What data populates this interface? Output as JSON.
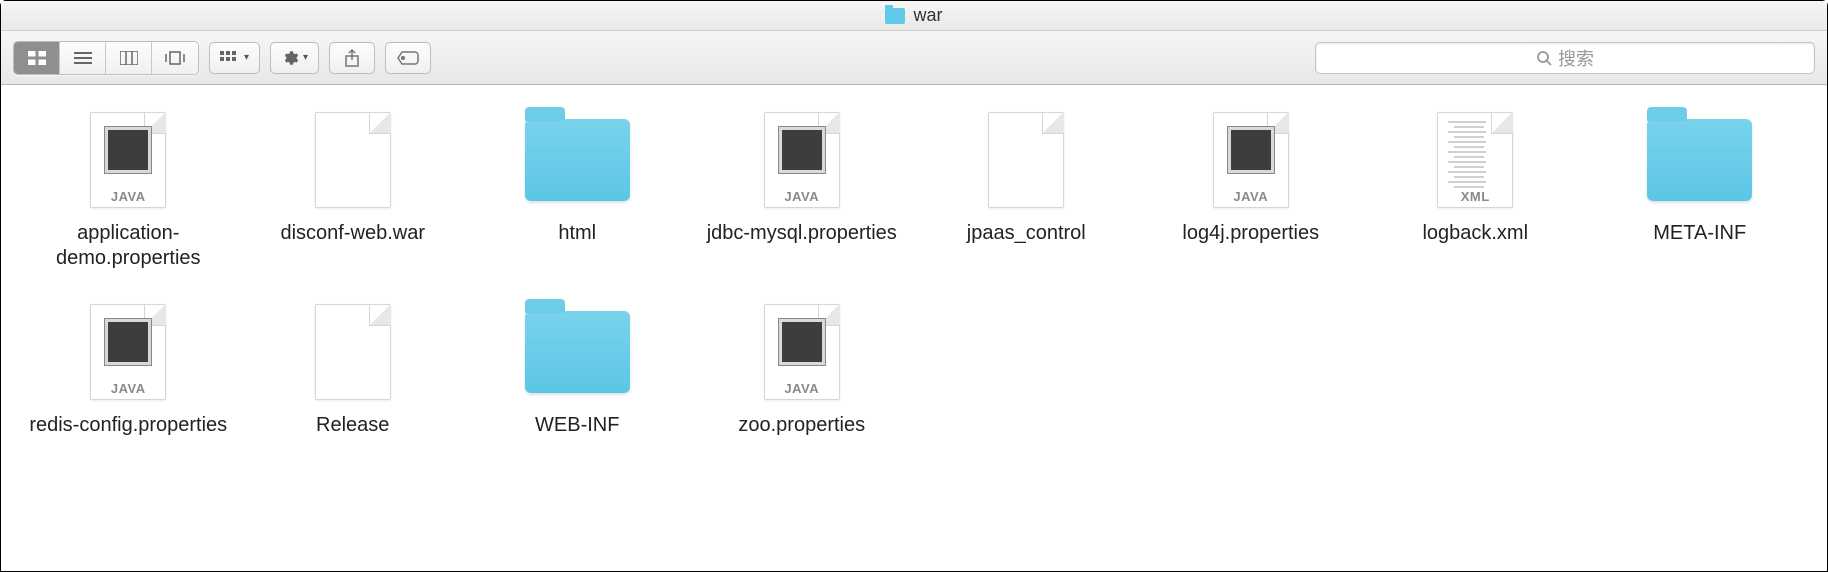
{
  "window": {
    "title": "war"
  },
  "toolbar": {
    "search_placeholder": "搜索"
  },
  "items": [
    {
      "name": "application-demo.properties",
      "type": "java"
    },
    {
      "name": "disconf-web.war",
      "type": "blank"
    },
    {
      "name": "html",
      "type": "folder"
    },
    {
      "name": "jdbc-mysql.properties",
      "type": "java"
    },
    {
      "name": "jpaas_control",
      "type": "blank"
    },
    {
      "name": "log4j.properties",
      "type": "java"
    },
    {
      "name": "logback.xml",
      "type": "xml"
    },
    {
      "name": "META-INF",
      "type": "folder"
    },
    {
      "name": "redis-config.properties",
      "type": "java"
    },
    {
      "name": "Release",
      "type": "blank"
    },
    {
      "name": "WEB-INF",
      "type": "folder"
    },
    {
      "name": "zoo.properties",
      "type": "java"
    }
  ],
  "icon_tags": {
    "java": "JAVA",
    "xml": "XML"
  }
}
